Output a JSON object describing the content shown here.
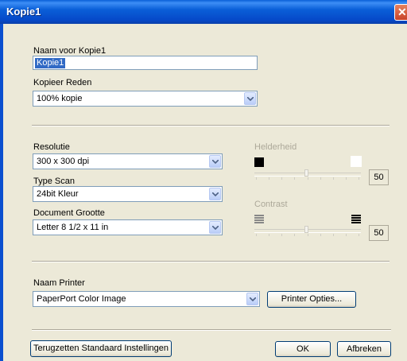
{
  "window": {
    "title": "Kopie1"
  },
  "name_field": {
    "label": "Naam voor Kopie1",
    "value": "Kopie1"
  },
  "reason": {
    "label": "Kopieer Reden",
    "value": "100% kopie"
  },
  "resolution": {
    "label": "Resolutie",
    "value": "300 x 300 dpi"
  },
  "scan_type": {
    "label": "Type Scan",
    "value": "24bit Kleur"
  },
  "doc_size": {
    "label": "Document Grootte",
    "value": "Letter 8 1/2 x 11 in"
  },
  "brightness": {
    "label": "Helderheid",
    "value": "50",
    "level_percent": 50,
    "enabled": false
  },
  "contrast": {
    "label": "Contrast",
    "value": "50",
    "level_percent": 50,
    "enabled": false
  },
  "printer": {
    "label": "Naam Printer",
    "value": "PaperPort Color Image",
    "options_button": "Printer Opties..."
  },
  "footer": {
    "reset_button": "Terugzetten Standaard Instellingen",
    "ok_button": "OK",
    "cancel_button": "Afbreken"
  },
  "colors": {
    "title_bar": "#0a5fd8",
    "dialog_bg": "#ece9d8",
    "selection": "#316ac5",
    "disabled_text": "#aca899"
  },
  "icons": {
    "close": "close-icon",
    "dropdown": "chevron-down-icon",
    "brightness_low": "black-square-icon",
    "brightness_high": "white-square-icon",
    "contrast_low": "contrast-low-icon",
    "contrast_high": "contrast-high-icon"
  }
}
